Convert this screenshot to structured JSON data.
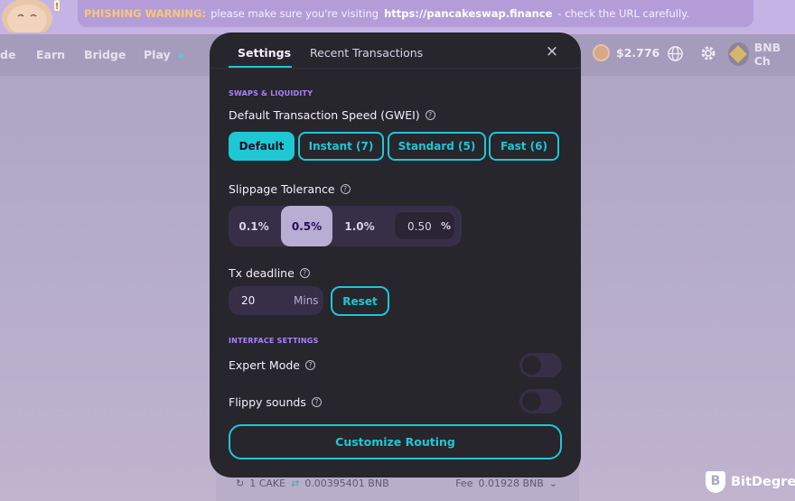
{
  "banner": {
    "warning_label": "PHISHING WARNING:",
    "message_before": "please make sure you're visiting",
    "url": "https://pancakeswap.finance",
    "message_after": "- check the URL carefully."
  },
  "nav": {
    "items": [
      {
        "label": "de"
      },
      {
        "label": "Earn"
      },
      {
        "label": "Bridge"
      },
      {
        "label": "Play"
      }
    ],
    "cake_price": "$2.776",
    "network": "BNB Ch"
  },
  "modal": {
    "tabs": [
      {
        "label": "Settings",
        "active": true
      },
      {
        "label": "Recent Transactions",
        "active": false
      }
    ],
    "close_icon": "×",
    "swaps_section_title": "SWAPS & LIQUIDITY",
    "tx_speed_label": "Default Transaction Speed (GWEI)",
    "speed_options": [
      {
        "label": "Default",
        "active": true
      },
      {
        "label": "Instant (7)",
        "active": false
      },
      {
        "label": "Standard (5)",
        "active": false
      },
      {
        "label": "Fast (6)",
        "active": false
      }
    ],
    "slippage_label": "Slippage Tolerance",
    "slippage_options": [
      {
        "label": "0.1%",
        "active": false
      },
      {
        "label": "0.5%",
        "active": true
      },
      {
        "label": "1.0%",
        "active": false
      }
    ],
    "slippage_custom_value": "0.50",
    "slippage_unit": "%",
    "deadline_label": "Tx deadline",
    "deadline_value": "20",
    "deadline_unit": "Mins",
    "reset_label": "Reset",
    "interface_section_title": "INTERFACE SETTINGS",
    "expert_mode_label": "Expert Mode",
    "expert_mode_on": false,
    "flippy_sounds_label": "Flippy sounds",
    "flippy_sounds_on": false,
    "customize_routing_label": "Customize Routing"
  },
  "bottom_card": {
    "pair_left": "1 CAKE",
    "swap_symbol": "⇄",
    "pair_right": "0.00395401 BNB",
    "fee_label": "Fee",
    "fee_value": "0.01928 BNB"
  },
  "watermark": {
    "brand": "BitDegree",
    "logo_letter": "B"
  },
  "colors": {
    "accent": "#1fc7d4",
    "secondary": "#a881fc",
    "modal_bg": "#27262c",
    "warning": "#f7c879"
  }
}
